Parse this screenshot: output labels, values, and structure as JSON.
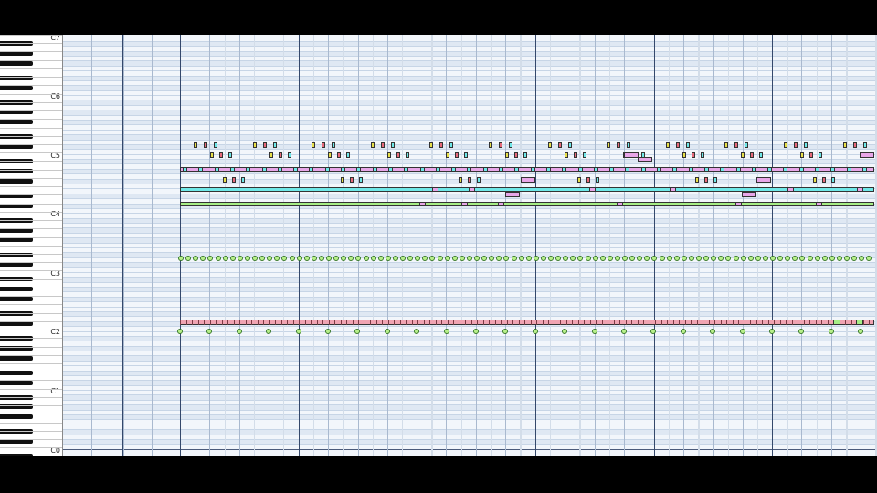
{
  "keyboard": {
    "octave_labels": [
      "C7",
      "C6",
      "C5",
      "C4",
      "C3",
      "C2",
      "C1",
      "C0"
    ]
  },
  "colors": {
    "background": "#000000",
    "grid": "#f2f6fb",
    "grid_black_row": "#dfe8f3",
    "bar_line": "#34486b",
    "note_yellow": "#e8e04a",
    "note_red": "#e86a7a",
    "note_cyan": "#6fe8e8",
    "note_magenta": "#e8a6e8",
    "note_green": "#a6ee86",
    "note_pink": "#f0a4b2"
  }
}
